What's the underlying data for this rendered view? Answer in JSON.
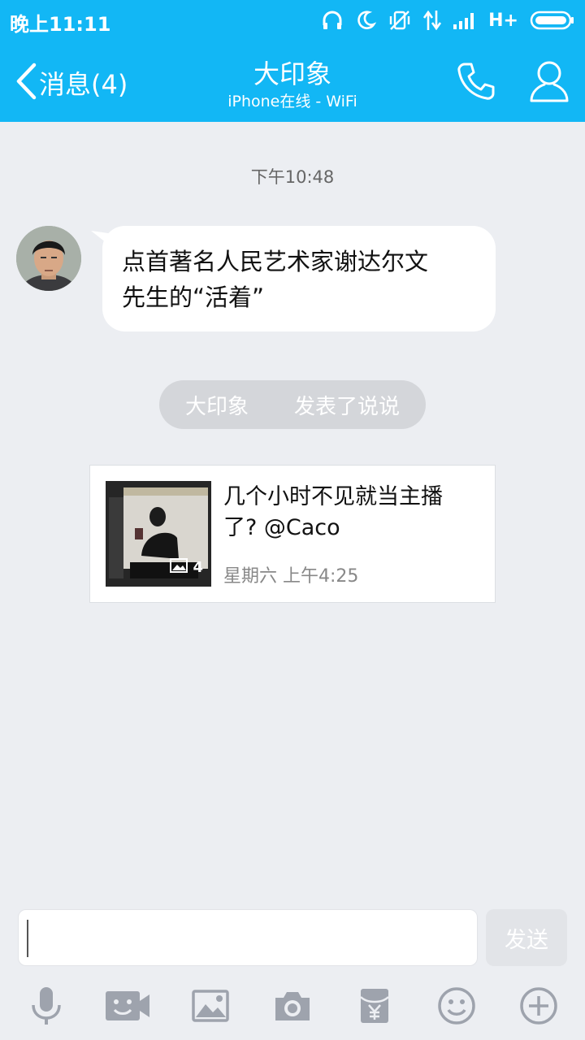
{
  "status_bar": {
    "time": "晚上11:11",
    "network": "H+",
    "icons": [
      "headset-icon",
      "moon-icon",
      "vibrate-off-icon",
      "data-arrows-icon",
      "signal-icon",
      "battery-icon"
    ]
  },
  "header": {
    "back_label": "消息(4)",
    "title": "大印象",
    "subtitle": "iPhone在线 - WiFi",
    "actions": [
      "phone-icon",
      "profile-icon"
    ],
    "color": "#12b7f5"
  },
  "chat": {
    "timestamp": "下午10:48",
    "message": {
      "line1": "点首著名人民艺术家谢达尔文",
      "line2": "先生的“活着”"
    },
    "system_notice": {
      "name": "大印象",
      "action": "发表了说说"
    },
    "post_card": {
      "text_line1": "几个小时不见就当主播",
      "text_line2": "了? @Caco",
      "photo_count": "4",
      "time": "星期六 上午4:25"
    }
  },
  "input": {
    "value": "",
    "send_label": "发送"
  },
  "toolbar": {
    "items": [
      "mic-icon",
      "video-icon",
      "image-icon",
      "camera-icon",
      "red-packet-icon",
      "emoji-icon",
      "plus-icon"
    ]
  }
}
